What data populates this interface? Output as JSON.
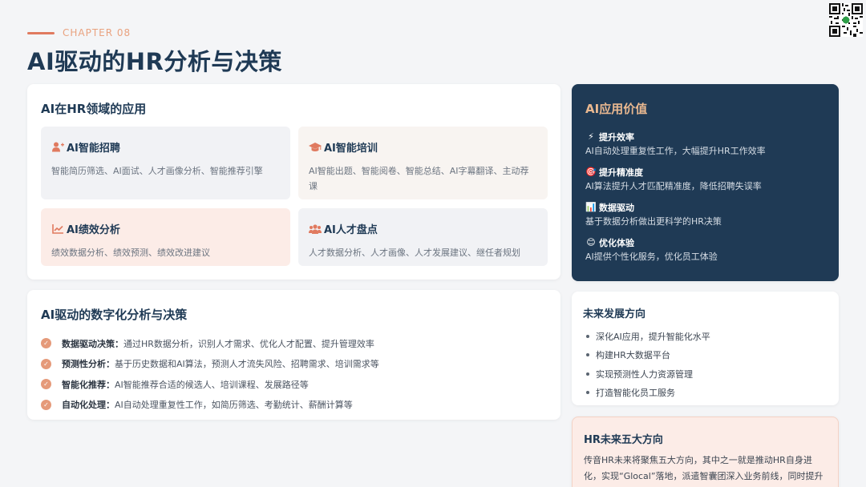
{
  "header": {
    "chapter": "CHAPTER 08",
    "title": "AI驱动的HR分析与决策"
  },
  "apps": {
    "title": "AI在HR领域的应用",
    "tiles": [
      {
        "icon": "user-plus-icon",
        "title": "AI智能招聘",
        "desc": "智能简历筛选、AI面试、人才画像分析、智能推荐引擎"
      },
      {
        "icon": "graduation-cap-icon",
        "title": "AI智能培训",
        "desc": "AI智能出题、智能阅卷、智能总结、AI字幕翻译、主动荐课"
      },
      {
        "icon": "line-chart-icon",
        "title": "AI绩效分析",
        "desc": "绩效数据分析、绩效预测、绩效改进建议"
      },
      {
        "icon": "users-icon",
        "title": "AI人才盘点",
        "desc": "人才数据分析、人才画像、人才发展建议、继任者规划"
      }
    ]
  },
  "digital": {
    "title": "AI驱动的数字化分析与决策",
    "items": [
      {
        "label": "数据驱动决策：",
        "text": "通过HR数据分析，识别人才需求、优化人才配置、提升管理效率"
      },
      {
        "label": "预测性分析：",
        "text": "基于历史数据和AI算法，预测人才流失风险、招聘需求、培训需求等"
      },
      {
        "label": "智能化推荐：",
        "text": "AI智能推荐合适的候选人、培训课程、发展路径等"
      },
      {
        "label": "自动化处理：",
        "text": "AI自动处理重复性工作，如简历筛选、考勤统计、薪酬计算等"
      }
    ]
  },
  "value": {
    "title": "AI应用价值",
    "items": [
      {
        "emoji": "⚡",
        "icon": "lightning-icon",
        "title": "提升效率",
        "desc": "AI自动处理重复性工作，大幅提升HR工作效率"
      },
      {
        "emoji": "🎯",
        "icon": "target-icon",
        "title": "提升精准度",
        "desc": "AI算法提升人才匹配精准度，降低招聘失误率"
      },
      {
        "emoji": "📊",
        "icon": "bar-chart-icon",
        "title": "数据驱动",
        "desc": "基于数据分析做出更科学的HR决策"
      },
      {
        "emoji": "😊",
        "icon": "smile-icon",
        "title": "优化体验",
        "desc": "AI提供个性化服务，优化员工体验"
      }
    ]
  },
  "future": {
    "title": "未来发展方向",
    "items": [
      "深化AI应用，提升智能化水平",
      "构建HR大数据平台",
      "实现预测性人力资源管理",
      "打造智能化员工服务"
    ]
  },
  "five": {
    "title": "HR未来五大方向",
    "desc": "传音HR未来将聚焦五大方向，其中之一就是推动HR自身进化，实现“Glocal”落地，派遣智囊团深入业务前线，同时提升AI驱动的数字化分析与决策能力。"
  },
  "colors": {
    "accent": "#e07a5f",
    "navy": "#1f3a55",
    "gold": "#e9b890"
  }
}
